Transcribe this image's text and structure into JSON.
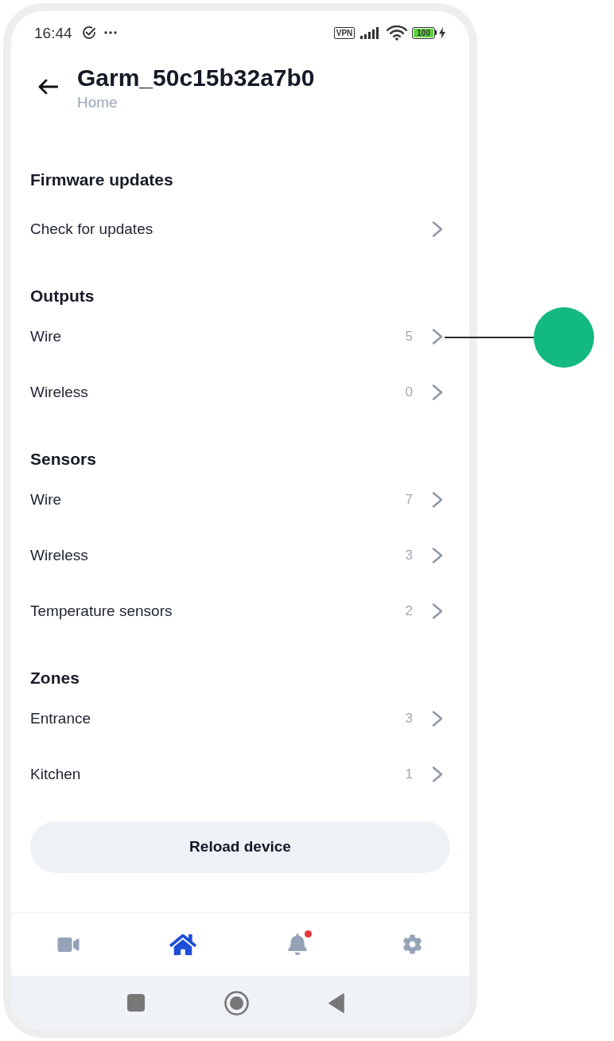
{
  "status_bar": {
    "time": "16:44",
    "vpn": "VPN",
    "battery": "100"
  },
  "header": {
    "title": "Garm_50c15b32a7b0",
    "subtitle": "Home"
  },
  "sections": [
    {
      "title": "Firmware updates",
      "rows": [
        {
          "label": "Check for updates"
        }
      ]
    },
    {
      "title": "Outputs",
      "rows": [
        {
          "label": "Wire",
          "count": "5"
        },
        {
          "label": "Wireless",
          "count": "0"
        }
      ]
    },
    {
      "title": "Sensors",
      "rows": [
        {
          "label": "Wire",
          "count": "7"
        },
        {
          "label": "Wireless",
          "count": "3"
        },
        {
          "label": "Temperature sensors",
          "count": "2"
        }
      ]
    },
    {
      "title": "Zones",
      "rows": [
        {
          "label": "Entrance",
          "count": "3"
        },
        {
          "label": "Kitchen",
          "count": "1"
        }
      ]
    }
  ],
  "reload_button": "Reload device",
  "bottom_nav": [
    {
      "selected": false,
      "badge": false
    },
    {
      "selected": true,
      "badge": false
    },
    {
      "selected": false,
      "badge": true
    },
    {
      "selected": false,
      "badge": false
    }
  ]
}
